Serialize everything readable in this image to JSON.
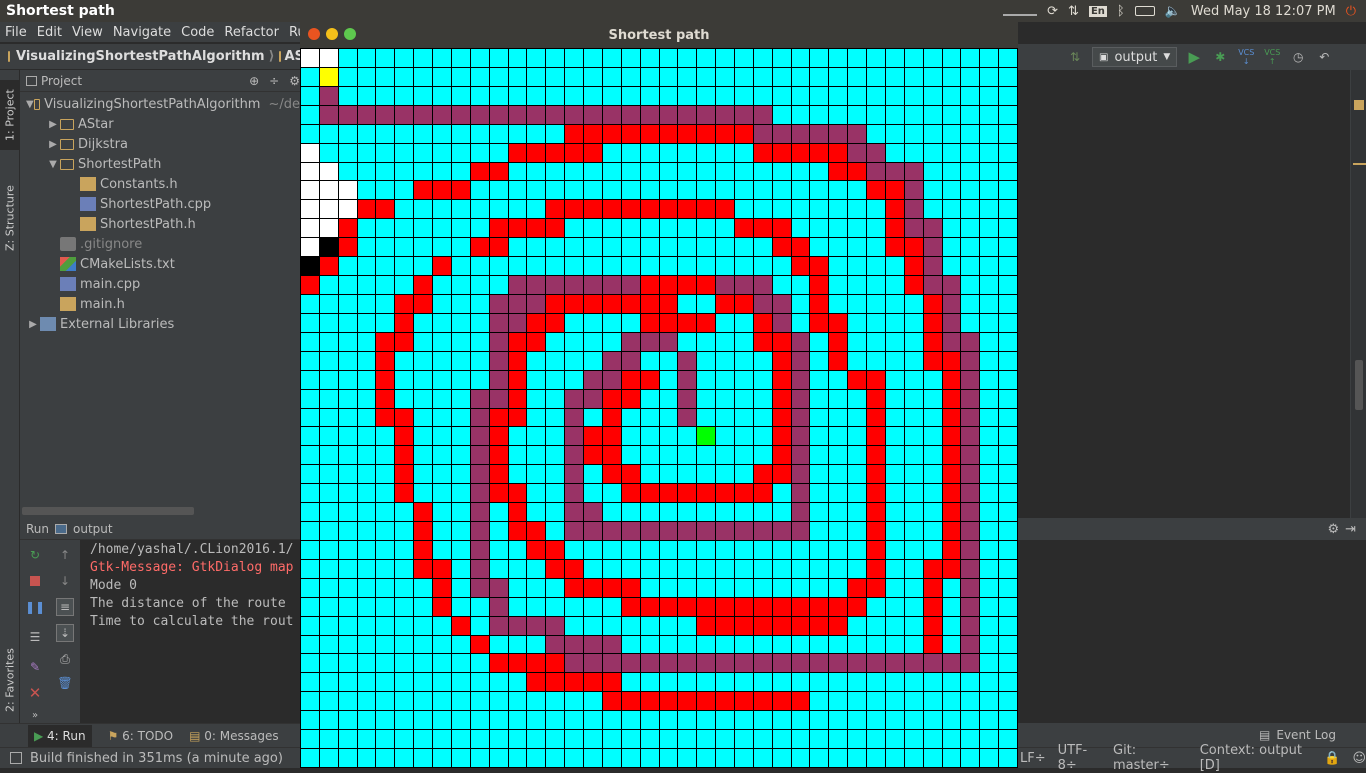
{
  "topbar": {
    "app_title": "Shortest path",
    "keyboard": "En",
    "datetime": "Wed May 18 12:07 PM"
  },
  "menubar": {
    "items": [
      "File",
      "Edit",
      "View",
      "Navigate",
      "Code",
      "Refactor",
      "Ru"
    ]
  },
  "navbar": {
    "project": "VisualizingShortestPathAlgorithm",
    "next_crumb": "AS"
  },
  "toolbar": {
    "run_config": "output",
    "vcs1": "VCS",
    "vcs2": "VCS"
  },
  "left_strip": {
    "project_tab": "1: Project",
    "structure_tab": "Z: Structure",
    "favorites_tab": "2: Favorites"
  },
  "project_panel": {
    "header": "Project",
    "tree": [
      {
        "label": "VisualizingShortestPathAlgorithm",
        "suffix": "~/de",
        "indent": 0,
        "arrow": "▼",
        "icon": "folder"
      },
      {
        "label": "AStar",
        "indent": 1,
        "arrow": "▶",
        "icon": "folder"
      },
      {
        "label": "Dijkstra",
        "indent": 1,
        "arrow": "▶",
        "icon": "folder"
      },
      {
        "label": "ShortestPath",
        "indent": 1,
        "arrow": "▼",
        "icon": "folder"
      },
      {
        "label": "Constants.h",
        "indent": 2,
        "arrow": "",
        "icon": "h"
      },
      {
        "label": "ShortestPath.cpp",
        "indent": 2,
        "arrow": "",
        "icon": "cpp"
      },
      {
        "label": "ShortestPath.h",
        "indent": 2,
        "arrow": "",
        "icon": "h"
      },
      {
        "label": ".gitignore",
        "indent": 1,
        "arrow": "",
        "icon": "git"
      },
      {
        "label": "CMakeLists.txt",
        "indent": 1,
        "arrow": "",
        "icon": "txt"
      },
      {
        "label": "main.cpp",
        "indent": 1,
        "arrow": "",
        "icon": "cpp"
      },
      {
        "label": "main.h",
        "indent": 1,
        "arrow": "",
        "icon": "h"
      },
      {
        "label": "External Libraries",
        "indent": 0,
        "arrow": "▶",
        "icon": "lib"
      }
    ]
  },
  "run_panel": {
    "label": "Run",
    "config": "output",
    "lines": [
      {
        "text": "/home/yashal/.CLion2016.1/",
        "kind": "normal"
      },
      {
        "text": "Gtk-Message: GtkDialog map",
        "kind": "err"
      },
      {
        "text": "Mode 0",
        "kind": "normal"
      },
      {
        "text": "The distance of the route",
        "kind": "normal"
      },
      {
        "text": "Time to calculate the rout",
        "kind": "normal"
      }
    ]
  },
  "bottom_tabs": {
    "run": "4: Run",
    "todo": "6: TODO",
    "messages": "0: Messages",
    "event_log": "Event Log"
  },
  "statusbar": {
    "message": "Build finished in 351ms (a minute ago)",
    "line_sep": "LF÷",
    "encoding": "UTF-8÷",
    "git": "Git: master÷",
    "context": "Context: output [D]"
  },
  "grid_window": {
    "title": "Shortest path",
    "cols": 38,
    "rows": 38,
    "colors": {
      "C": "#00ffff",
      "R": "#ff0000",
      "P": "#993366",
      "W": "#ffffff",
      "K": "#000000",
      "Y": "#ffff00",
      "G": "#00ff00"
    },
    "cells": [
      "WWCCCCCCCCCCCCCCCCCCCCCCCCCCCCCCCCCCCC",
      "CYCCCCCCCCCCCCCCCCCCCCCCCCCCCCCCCCCCCC",
      "CPCCCCCCCCCCCCCCCCCCCCCCCCCCCCCCCCCCCC",
      "CPPPPPPPPPPPPPPPPPPPPPPPPCCCCCCCCCCCCC",
      "CCCCCCCCCCCCCCRRRRRRRRRRPPPPPPCCCCCCCC",
      "WCCCCCCCCCCRRRRRCCCCCCCCRRRRRPPCCCCCCC",
      "WWCCCCCCCRRCCCCCCCCCCCCCCCCCRRPPPCCCCC",
      "WWWCCCRRRCCCCCCCCCCCCCCCCCCCCCRRPCCCCC",
      "WWWRRCCCCCCCCRRRRRRRRRRCCCCCCCCRPCCCCC",
      "WWRCCCCCCCRRRRCCCCCCCCCRRRCCCCCRPPCCCC",
      "WKRCCCCCCRRCCCCCCCCCCCCCCRRCCCCRRPCCCC",
      "KRCCCCCRCCCCCCCCCCCCCCCCCCRRCCCCRPCCCC",
      "RCCCCCRCCCCPPPPPPPRRRRPPPCCRCCCCRPPCCC",
      "CCCCCRRCCCPPPRRRRRRRCCRRPPCRCCCCCRPCCC",
      "CCCCCRCCCCPPRRCCCCRRRRCCRPCRRCCCCRPCCC",
      "CCCCRRCCCCPRRCCCCPPPCCCCRRPCRCCCCRPPCC",
      "CCCCRCCCCCPRCCCCPPCCPCCCCRPCRCCCCRRPCC",
      "CCCCRCCCCCPRCCCPPRRCPCCCCRPCCRRCCCRPCC",
      "CCCCRCCCCPPRCCPPRRCCPCCCCRPCCCRCCCRPCC",
      "CCCCRRCCCPRRCCPCRCCCPCCCCRPCCCRCCCRPCC",
      "CCCCCRCCCPRCCCPRRCCCCGCCCRPCCCRCCCRPCC",
      "CCCCCRCCCPRCCCPRRCCCCCCCCRPCCCRCCCRPCC",
      "CCCCCRCCCPRCCCPCRRCCCCCCRRPCCCRCCCRPCC",
      "CCCCCRCCCPRRCCPCCRRRRRRRRCPCCCRCCCRPCC",
      "CCCCCCRCCPCRCCPPCCCCCCCCCCPCCCRCCCRPCC",
      "CCCCCCRCCPCRRCPPPPPPPPPPPPPCCCRCCCRPCC",
      "CCCCCCRCCPCCRRCCCCCCCCCCCCCCCCRCCCRPCC",
      "CCCCCCRRCPCCCRRCCCCCCCCCCCCCCCRCCRRPCC",
      "CCCCCCCRCPPCCCRRRRCCCCCCCCCCCRRCCRCPCC",
      "CCCCCCCRCCPCCCCCCRRRRRRRRRRRRRCCCRCPCC",
      "CCCCCCCCRCPPPPCCCCCCCRRRRRRRRCCCCRCPCC",
      "CCCCCCCCCRCCCPPPPCCCCCCCCCCCCCCCCRCPCC",
      "CCCCCCCCCCRRRRPPPPPPPPPPPPPPPPPPPPPPCC",
      "CCCCCCCCCCCCRRRRRCCCCCCCCCCCCCCCCCCCCC",
      "CCCCCCCCCCCCCCCCRRRRRRRRRRRCCCCCCCCCCC",
      "CCCCCCCCCCCCCCCCCCCCCCCCCCCCCCCCCCCCCC",
      "CCCCCCCCCCCCCCCCCCCCCCCCCCCCCCCCCCCCCC",
      "CCCCCCCCCCCCCCCCCCCCCCCCCCCCCCCCCCCCCC"
    ]
  }
}
